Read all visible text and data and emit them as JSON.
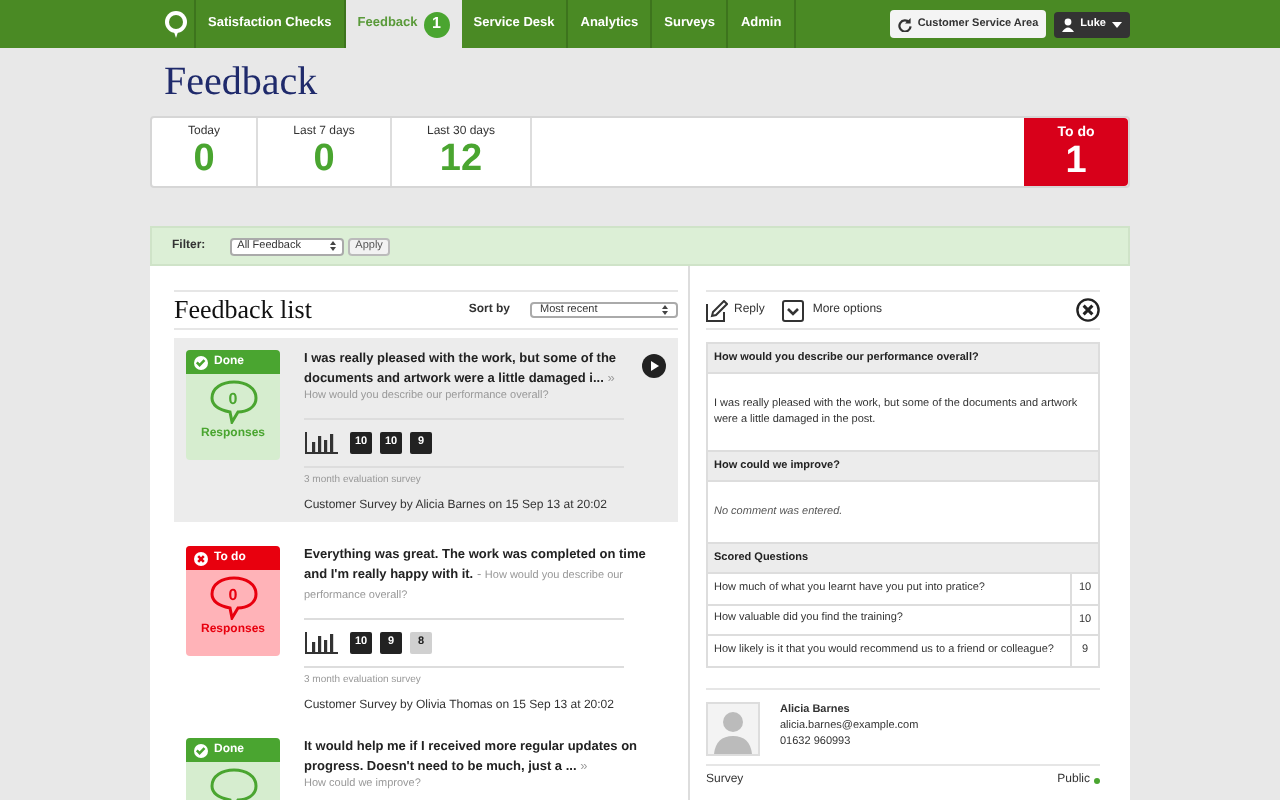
{
  "nav": {
    "items": [
      {
        "label": "Satisfaction Checks",
        "selected": false
      },
      {
        "label": "Feedback",
        "selected": true,
        "badge": "1"
      },
      {
        "label": "Service Desk",
        "selected": false
      },
      {
        "label": "Analytics",
        "selected": false
      },
      {
        "label": "Surveys",
        "selected": false
      },
      {
        "label": "Admin",
        "selected": false
      }
    ],
    "area_button": "Customer Service Area",
    "user": "Luke"
  },
  "page_title": "Feedback",
  "stats": [
    {
      "label": "Today",
      "value": "0"
    },
    {
      "label": "Last 7 days",
      "value": "0"
    },
    {
      "label": "Last 30 days",
      "value": "12"
    }
  ],
  "todo": {
    "label": "To do",
    "value": "1"
  },
  "filter": {
    "label": "Filter:",
    "value": "All Feedback",
    "button": "Apply"
  },
  "list": {
    "title": "Feedback list",
    "sort_label": "Sort by",
    "sort_value": "Most recent",
    "items": [
      {
        "kind": "done",
        "status_label": "Done",
        "responses": "0",
        "responses_label": "Responses",
        "selected": true,
        "comment": "I was really pleased with the work, but some of the documents and artwork were a little damaged i...",
        "more": "»",
        "question": "How would you describe our performance overall?",
        "scores": [
          {
            "value": "10",
            "kind": "dark"
          },
          {
            "value": "10",
            "kind": "dark"
          },
          {
            "value": "9",
            "kind": "dark"
          }
        ],
        "survey": "3 month evaluation survey",
        "meta": "Customer Survey by Alicia Barnes on 15 Sep 13 at 20:02"
      },
      {
        "kind": "todo",
        "status_label": "To do",
        "responses": "0",
        "responses_label": "Responses",
        "selected": false,
        "comment": "Everything was great. The work was completed on time and I'm really happy with it.",
        "more": "-",
        "question": "How would you describe our performance overall?",
        "scores": [
          {
            "value": "10",
            "kind": "dark"
          },
          {
            "value": "9",
            "kind": "dark"
          },
          {
            "value": "8",
            "kind": "light"
          }
        ],
        "survey": "3 month evaluation survey",
        "meta": "Customer Survey by Olivia Thomas on 15 Sep 13 at 20:02"
      },
      {
        "kind": "done",
        "status_label": "Done",
        "selected": false,
        "comment": "It would help me if I received more regular updates on progress. Doesn't need to be much, just a ...",
        "more": "»",
        "question": "How could we improve?"
      }
    ]
  },
  "detail": {
    "reply": "Reply",
    "more_options": "More options",
    "sections": [
      {
        "heading": "How would you describe our performance overall?",
        "body": "I was really pleased with the work, but some of the documents and artwork were a little damaged in the post.",
        "muted": false
      },
      {
        "heading": "How could we improve?",
        "body": "No comment was entered.",
        "muted": true
      }
    ],
    "scored_heading": "Scored Questions",
    "scored": [
      {
        "question": "How much of what you learnt have you put into pratice?",
        "score": "10"
      },
      {
        "question": "How valuable did you find the training?",
        "score": "10"
      },
      {
        "question": "How likely is it that you would recommend us to a friend or colleague?",
        "score": "9"
      }
    ],
    "person": {
      "name": "Alicia Barnes",
      "email": "alicia.barnes@example.com",
      "phone": "01632 960993"
    },
    "footer_label": "Survey",
    "visibility": "Public"
  }
}
